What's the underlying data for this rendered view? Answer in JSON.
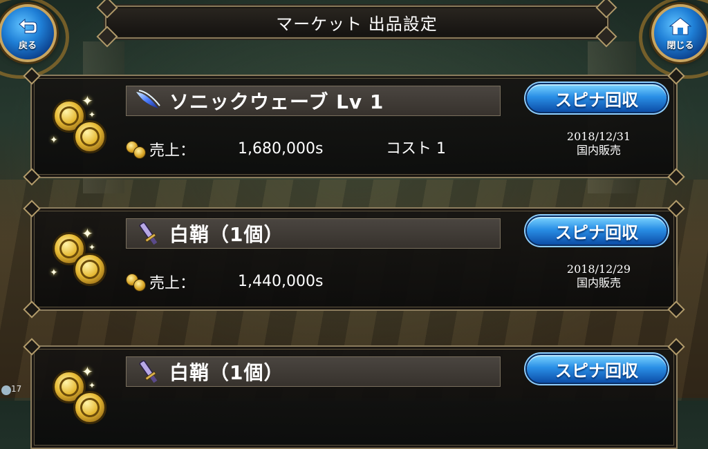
{
  "header": {
    "title": "マーケット 出品設定",
    "back_label": "戻る",
    "close_label": "閉じる"
  },
  "listings": [
    {
      "item_name": "ソニックウェーブ Lv 1",
      "item_icon": "blue-skill-icon",
      "recover_label": "スピナ回収",
      "sales_label": "売上：",
      "sales_value": "1,680,000s",
      "cost_text": "コスト 1",
      "date": "2018/12/31",
      "region": "国内販売"
    },
    {
      "item_name": "白鞘（1個）",
      "item_icon": "sword-icon",
      "recover_label": "スピナ回収",
      "sales_label": "売上：",
      "sales_value": "1,440,000s",
      "cost_text": "",
      "date": "2018/12/29",
      "region": "国内販売"
    },
    {
      "item_name": "白鞘（1個）",
      "item_icon": "sword-icon",
      "recover_label": "スピナ回収"
    }
  ],
  "footer": {
    "text": "17"
  },
  "colors": {
    "accent_blue": "#2a8fe6",
    "gold_frame": "#c8a560",
    "panel_border": "#8c7d5e"
  }
}
